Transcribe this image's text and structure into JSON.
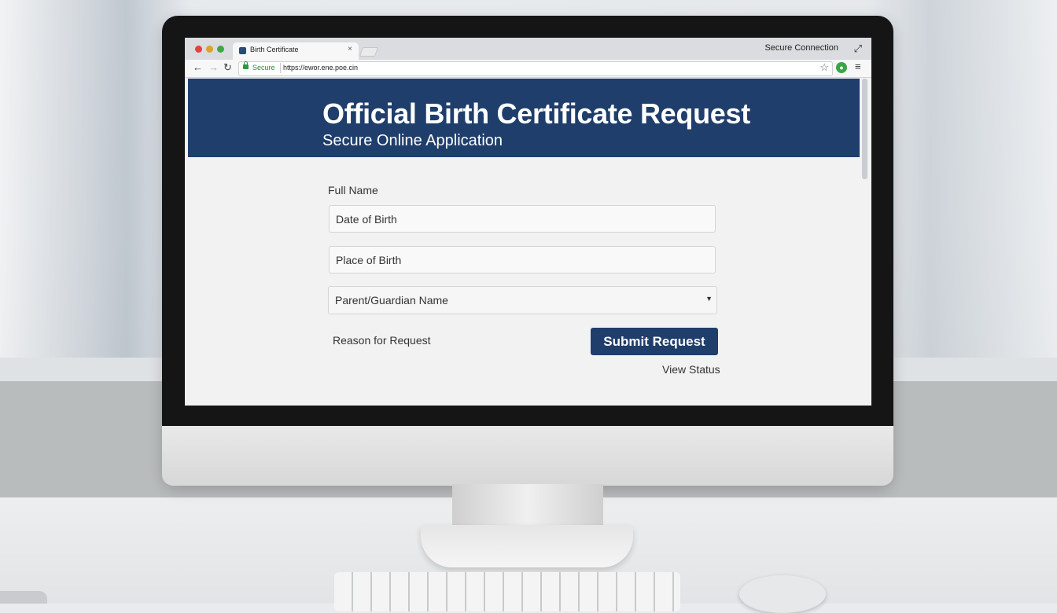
{
  "browser": {
    "tab_title": "Birth Certificate",
    "tab_close": "×",
    "connection_status": "Secure Connection",
    "secure_label": "Secure",
    "url": "https://ewor.ene.poe.cin"
  },
  "page": {
    "title": "Official Birth Certificate Request",
    "subtitle": "Secure Online Application"
  },
  "form": {
    "full_name_label": "Full Name",
    "dob_placeholder": "Date of Birth",
    "pob_placeholder": "Place of Birth",
    "parent_select_value": "Parent/Guardian Name",
    "reason_label": "Reason for Request",
    "submit_label": "Submit Request",
    "view_status_label": "View Status"
  },
  "colors": {
    "banner": "#1f3e6b",
    "submit_button": "#1f3e6b",
    "secure_green": "#2c9a3b"
  },
  "icons": {
    "back": "←",
    "forward": "→",
    "reload": "↻",
    "star": "☆",
    "menu": "≡",
    "caret": "▼",
    "expand": "⤢"
  }
}
